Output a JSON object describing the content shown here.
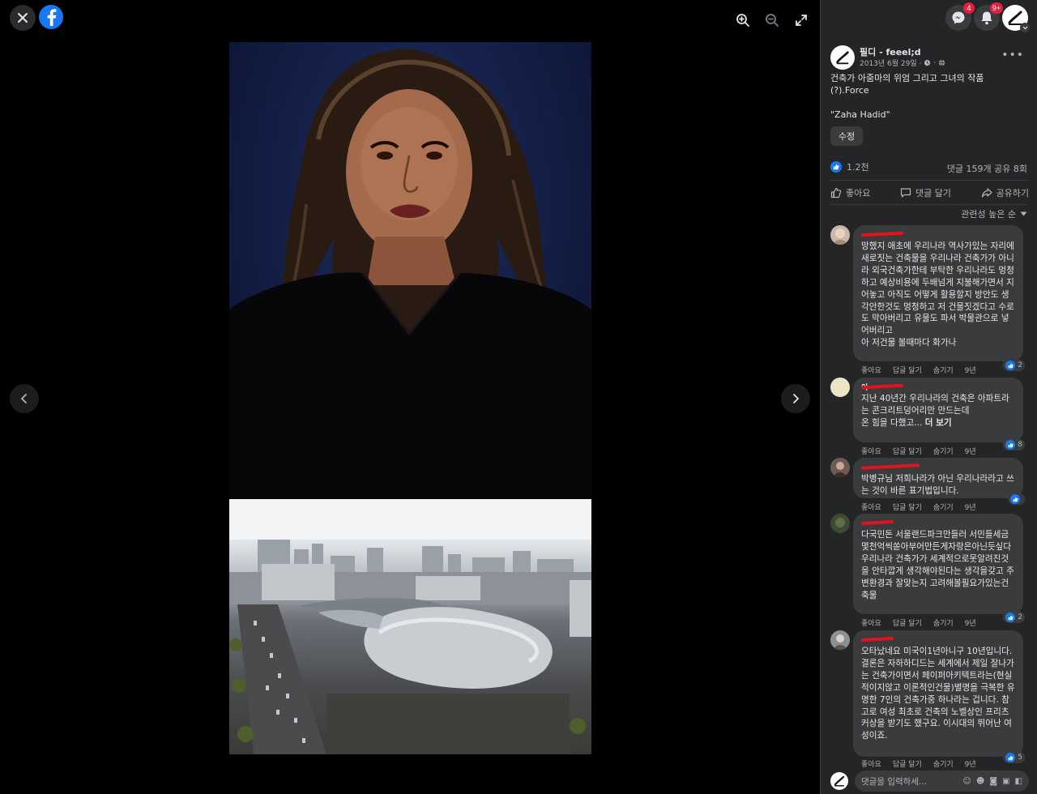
{
  "viewer": {
    "tools": [
      "zoom-in-icon",
      "zoom-out-icon",
      "fullscreen-icon"
    ]
  },
  "header": {
    "messenger_badge": "4",
    "notifications_badge": "9+"
  },
  "post": {
    "page_name": "필디 - feeel;d",
    "date": "2013년 6월 29일 ·",
    "text_line1": "건축가 아줌마의 위엄 그리고 그녀의 작품",
    "text_line2": "(?).Force",
    "text_line3": "\"Zaha Hadid\"",
    "edit_label": "수정",
    "reaction_count": "1.2천",
    "comment_share_counts": "댓글 159개  공유 8회",
    "like_label": "좋아요",
    "comment_label": "댓글 달기",
    "share_label": "공유하기",
    "sort_label": "관련성 높은 순"
  },
  "comments": [
    {
      "text": "망했지 애초에 우리나라 역사가있는 자리에 새로짓는 건축물을 우리나라 건축가가 아니라 외국건축가한테 부탁한 우리나라도 멍청하고 예상비용에 두배넘게 지불해가면서 지어놓고 아직도 어떻게 활용할지 방안도 생각안한것도 멍청하고 저 건물짓겠다고 수로도 막아버리고 유물도 파서 박물관으로 넣어버리고\n아 저건물 볼때마다 화가나",
      "meta": [
        "좋아요",
        "답글 달기",
        "숨기기",
        "9년"
      ],
      "reactions": "2"
    },
    {
      "name": "이",
      "text": "지난 40년간 우리나라의 건축은 아파트라는 콘크리트덩어리만 만드는데\n온 힘을 다했고... ",
      "more": "더 보기",
      "meta": [
        "좋아요",
        "답글 달기",
        "숨기기",
        "9년"
      ],
      "reactions": "8"
    },
    {
      "text": "박병규님 저희나라가 아닌 우리나라라고 쓰는 것이 바른 표기법입니다.",
      "meta": [
        "좋아요",
        "답글 달기",
        "숨기기",
        "9년"
      ],
      "reactions": ""
    },
    {
      "text": "다국민돈 서울랜드파크만들러 서민들세금 몇천억씩쏟아부어만든게자랑은아닌듯싶다 우리나라 건축가가 세계적으로못알려진것을 안타깝게 생각해야된다는 생각을갖고 주변환경과 잘맞는지 고려해볼필요가있는건축물",
      "meta": [
        "좋아요",
        "답글 달기",
        "숨기기",
        "9년"
      ],
      "reactions": "2"
    },
    {
      "text": "오타났네요 미국이1년아니구 10년입니다. 결론은 자하하디드는 세계에서 제일 잘나가는 건축가이면서 페이퍼아키텍트라는(현실적이지않고 이론적인건물)별명을 극복한 유명한 7인의 건축가중 하나라는 겁니다. 참고로 여성 최초로 건축의 노벨상인 프리츠커상을 받기도 했구요. 이시대의 뛰어난 여성이죠.",
      "meta": [
        "좋아요",
        "답글 달기",
        "숨기기",
        "9년"
      ],
      "reactions": "5"
    }
  ],
  "composer": {
    "placeholder": "댓글을 입력하세..."
  },
  "colors": {
    "panel_bg": "#242526",
    "bubble_bg": "#3a3b3c",
    "accent": "#1877f2",
    "badge": "#e41e3f"
  }
}
